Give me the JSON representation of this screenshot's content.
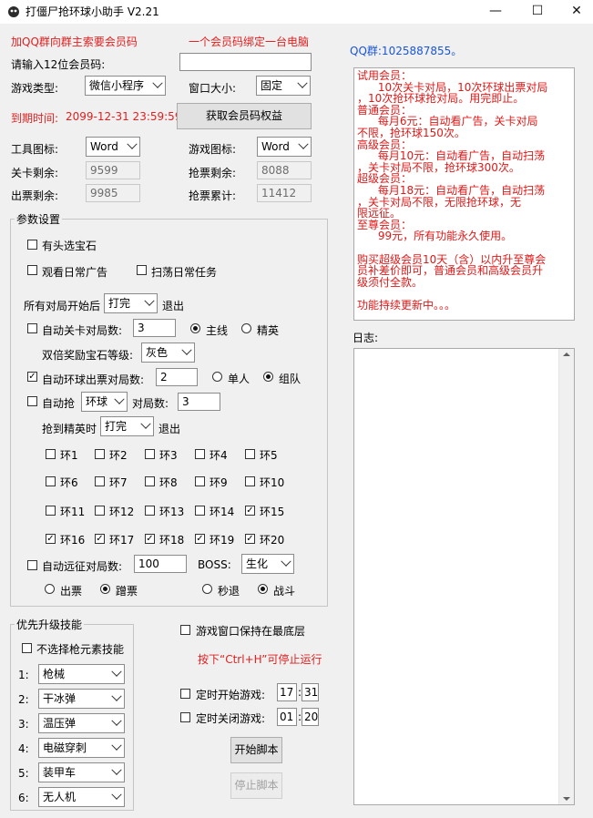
{
  "window": {
    "title": "打僵尸抢环球小助手 V2.21"
  },
  "header": {
    "join_group": "加QQ群向群主索要会员码",
    "one_device": "一个会员码绑定一台电脑",
    "qq_group": "QQ群:1025887855。"
  },
  "member": {
    "code_label": "请输入12位会员码:",
    "code_value": "",
    "expiry_label": "到期时间:",
    "expiry_value": "2099-12-31 23:59:59",
    "get_rights_button": "获取会员码权益"
  },
  "settings": {
    "game_type_label": "游戏类型:",
    "game_type_value": "微信小程序",
    "window_size_label": "窗口大小:",
    "window_size_value": "固定",
    "tool_icon_label": "工具图标:",
    "tool_icon_value": "Word",
    "game_icon_label": "游戏图标:",
    "game_icon_value": "Word",
    "level_left_label": "关卡剩余:",
    "level_left_value": "9599",
    "grab_left_label": "抢票剩余:",
    "grab_left_value": "8088",
    "ticket_left_label": "出票剩余:",
    "ticket_left_value": "9985",
    "grab_total_label": "抢票累计:",
    "grab_total_value": "11412"
  },
  "params": {
    "title": "参数设置",
    "head_chest": "有头选宝石",
    "daily_ads": "观看日常广告",
    "sweep_daily": "扫荡日常任务",
    "after_all_prefix": "所有对局开始后",
    "after_all_value": "打完",
    "after_all_suffix": "退出",
    "auto_level": "自动关卡对局数:",
    "auto_level_value": "3",
    "mainline": "主线",
    "elite": "精英",
    "double_reward_label": "双倍奖励宝石等级:",
    "double_reward_value": "灰色",
    "auto_ring_ticket": "自动环球出票对局数:",
    "auto_ring_value": "2",
    "single": "单人",
    "team": "组队",
    "auto_grab": "自动抢",
    "auto_grab_type": "环球",
    "auto_grab_count_label": "对局数:",
    "auto_grab_count": "3",
    "elite_grab_label": "抢到精英时",
    "elite_grab_value": "打完",
    "elite_grab_suffix": "退出",
    "rings": [
      {
        "label": "环1",
        "checked": false
      },
      {
        "label": "环2",
        "checked": false
      },
      {
        "label": "环3",
        "checked": false
      },
      {
        "label": "环4",
        "checked": false
      },
      {
        "label": "环5",
        "checked": false
      },
      {
        "label": "环6",
        "checked": false
      },
      {
        "label": "环7",
        "checked": false
      },
      {
        "label": "环8",
        "checked": false
      },
      {
        "label": "环9",
        "checked": false
      },
      {
        "label": "环10",
        "checked": false
      },
      {
        "label": "环11",
        "checked": false
      },
      {
        "label": "环12",
        "checked": false
      },
      {
        "label": "环13",
        "checked": false
      },
      {
        "label": "环14",
        "checked": false
      },
      {
        "label": "环15",
        "checked": true
      },
      {
        "label": "环16",
        "checked": true
      },
      {
        "label": "环17",
        "checked": true
      },
      {
        "label": "环18",
        "checked": true
      },
      {
        "label": "环19",
        "checked": true
      },
      {
        "label": "环20",
        "checked": true
      }
    ],
    "auto_expedition": "自动远征对局数:",
    "auto_expedition_value": "100",
    "boss_label": "BOSS:",
    "boss_value": "生化",
    "out_ticket": "出票",
    "step_ticket": "蹭票",
    "instant_retreat": "秒退",
    "fight": "战斗"
  },
  "skills": {
    "title": "优先升级技能",
    "no_gun_element": "不选择枪元素技能",
    "items": [
      {
        "num": "1:",
        "value": "枪械"
      },
      {
        "num": "2:",
        "value": "干冰弹"
      },
      {
        "num": "3:",
        "value": "温压弹"
      },
      {
        "num": "4:",
        "value": "电磁穿刺"
      },
      {
        "num": "5:",
        "value": "装甲车"
      },
      {
        "num": "6:",
        "value": "无人机"
      }
    ]
  },
  "controls": {
    "keep_top": "游戏窗口保持在最底层",
    "hotkey_hint": "按下“Ctrl+H”可停止运行",
    "timed_start": "定时开始游戏:",
    "start_h": "17",
    "start_m": "31",
    "timed_close": "定时关闭游戏:",
    "close_h": "01",
    "close_m": "20",
    "start_script": "开始脚本",
    "stop_script": "停止脚本",
    "colon": ":"
  },
  "membership_info": {
    "lines": [
      "试用会员：",
      "      10次关卡对局，10次环球出票对局",
      "，10次抢环球抢对局。用完即止。",
      "普通会员：",
      "      每月6元：自动看广告，关卡对局",
      "不限，抢环球150次。",
      "高级会员：",
      "      每月10元：自动看广告，自动扫荡",
      "，关卡对局不限，抢环球300次。",
      "超级会员：",
      "      每月18元：自动看广告，自动扫荡",
      "，关卡对局不限，无限抢环球，无",
      "限远征。",
      "至尊会员：",
      "      99元，所有功能永久使用。",
      "",
      "购买超级会员10天（含）以内升至尊会",
      "员补差价即可，普通会员和高级会员升",
      "级须付全款。",
      "",
      "功能持续更新中。。。"
    ]
  },
  "log": {
    "label": "日志:",
    "content": ""
  },
  "colors": {
    "red": "#e02020",
    "blue": "#1a56d6"
  }
}
